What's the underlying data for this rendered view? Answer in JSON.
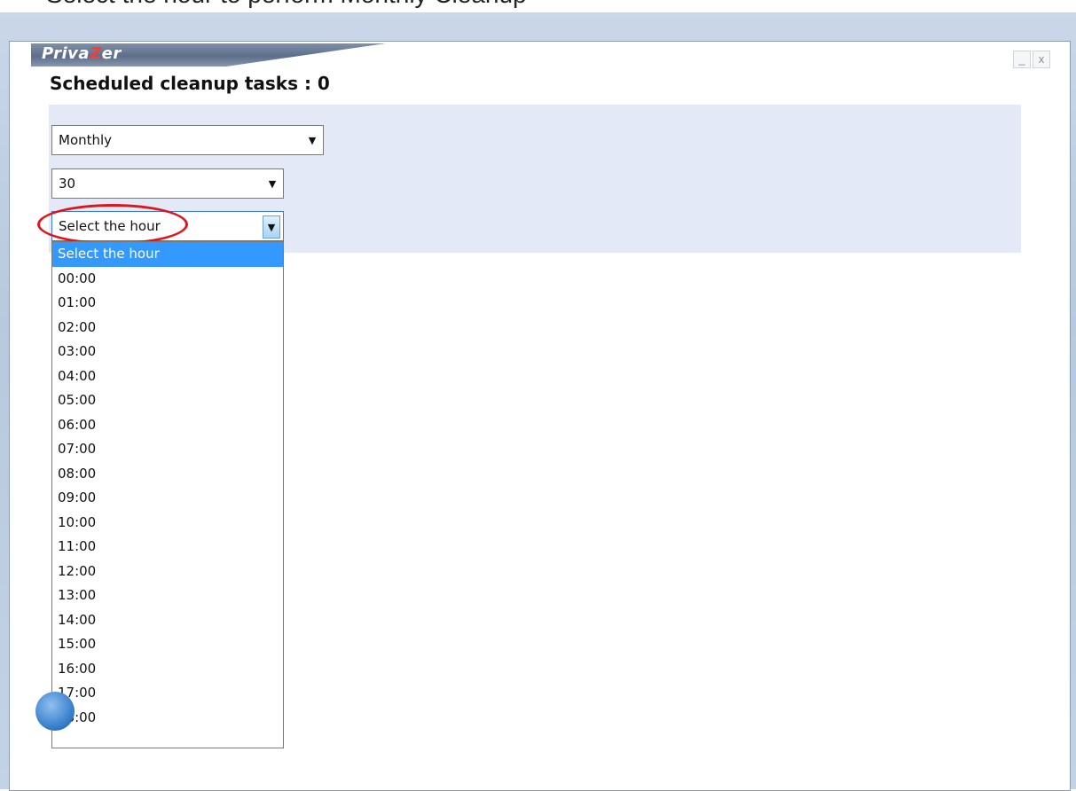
{
  "caption": "Select the hour to perform Monthly Cleanup",
  "app": {
    "logo_pre": "Priva",
    "logo_z": "Z",
    "logo_post": "er"
  },
  "window_controls": {
    "minimize": "_",
    "close": "x"
  },
  "heading": "Scheduled cleanup tasks : 0",
  "frequency_combo": {
    "value": "Monthly"
  },
  "day_combo": {
    "value": "30"
  },
  "hour_combo": {
    "value": "Select the hour"
  },
  "hour_options": [
    "Select the hour",
    "00:00",
    "01:00",
    "02:00",
    "03:00",
    "04:00",
    "05:00",
    "06:00",
    "07:00",
    "08:00",
    "09:00",
    "10:00",
    "11:00",
    "12:00",
    "13:00",
    "14:00",
    "15:00",
    "16:00",
    "17:00",
    "18:00"
  ],
  "selected_option_index": 0,
  "colors": {
    "selection": "#3399ff",
    "panel": "#e3e9f6",
    "highlight": "#e0141b"
  }
}
